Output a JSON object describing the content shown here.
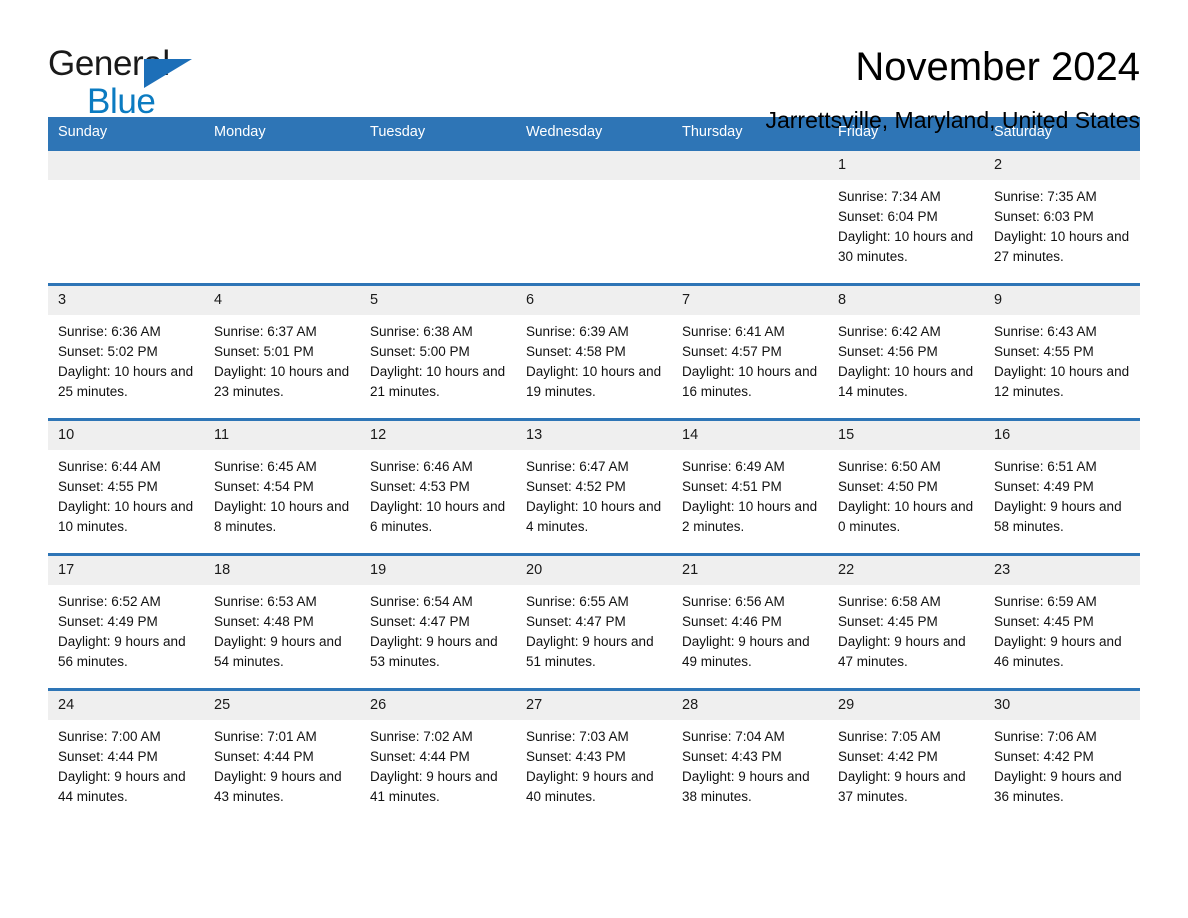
{
  "brand": {
    "name_part1": "General",
    "name_part2": "Blue",
    "triangle_color": "#1d6fb8",
    "blue_text_color": "#0b7bc1"
  },
  "header": {
    "month_title": "November 2024",
    "location": "Jarrettsville, Maryland, United States"
  },
  "theme": {
    "header_blue": "#2e75b6",
    "day_number_bg": "#efefef"
  },
  "calendar": {
    "weekday_headers": [
      "Sunday",
      "Monday",
      "Tuesday",
      "Wednesday",
      "Thursday",
      "Friday",
      "Saturday"
    ],
    "weeks": [
      [
        {
          "day": "",
          "empty": true
        },
        {
          "day": "",
          "empty": true
        },
        {
          "day": "",
          "empty": true
        },
        {
          "day": "",
          "empty": true
        },
        {
          "day": "",
          "empty": true
        },
        {
          "day": "1",
          "sunrise": "Sunrise: 7:34 AM",
          "sunset": "Sunset: 6:04 PM",
          "daylight": "Daylight: 10 hours and 30 minutes."
        },
        {
          "day": "2",
          "sunrise": "Sunrise: 7:35 AM",
          "sunset": "Sunset: 6:03 PM",
          "daylight": "Daylight: 10 hours and 27 minutes."
        }
      ],
      [
        {
          "day": "3",
          "sunrise": "Sunrise: 6:36 AM",
          "sunset": "Sunset: 5:02 PM",
          "daylight": "Daylight: 10 hours and 25 minutes."
        },
        {
          "day": "4",
          "sunrise": "Sunrise: 6:37 AM",
          "sunset": "Sunset: 5:01 PM",
          "daylight": "Daylight: 10 hours and 23 minutes."
        },
        {
          "day": "5",
          "sunrise": "Sunrise: 6:38 AM",
          "sunset": "Sunset: 5:00 PM",
          "daylight": "Daylight: 10 hours and 21 minutes."
        },
        {
          "day": "6",
          "sunrise": "Sunrise: 6:39 AM",
          "sunset": "Sunset: 4:58 PM",
          "daylight": "Daylight: 10 hours and 19 minutes."
        },
        {
          "day": "7",
          "sunrise": "Sunrise: 6:41 AM",
          "sunset": "Sunset: 4:57 PM",
          "daylight": "Daylight: 10 hours and 16 minutes."
        },
        {
          "day": "8",
          "sunrise": "Sunrise: 6:42 AM",
          "sunset": "Sunset: 4:56 PM",
          "daylight": "Daylight: 10 hours and 14 minutes."
        },
        {
          "day": "9",
          "sunrise": "Sunrise: 6:43 AM",
          "sunset": "Sunset: 4:55 PM",
          "daylight": "Daylight: 10 hours and 12 minutes."
        }
      ],
      [
        {
          "day": "10",
          "sunrise": "Sunrise: 6:44 AM",
          "sunset": "Sunset: 4:55 PM",
          "daylight": "Daylight: 10 hours and 10 minutes."
        },
        {
          "day": "11",
          "sunrise": "Sunrise: 6:45 AM",
          "sunset": "Sunset: 4:54 PM",
          "daylight": "Daylight: 10 hours and 8 minutes."
        },
        {
          "day": "12",
          "sunrise": "Sunrise: 6:46 AM",
          "sunset": "Sunset: 4:53 PM",
          "daylight": "Daylight: 10 hours and 6 minutes."
        },
        {
          "day": "13",
          "sunrise": "Sunrise: 6:47 AM",
          "sunset": "Sunset: 4:52 PM",
          "daylight": "Daylight: 10 hours and 4 minutes."
        },
        {
          "day": "14",
          "sunrise": "Sunrise: 6:49 AM",
          "sunset": "Sunset: 4:51 PM",
          "daylight": "Daylight: 10 hours and 2 minutes."
        },
        {
          "day": "15",
          "sunrise": "Sunrise: 6:50 AM",
          "sunset": "Sunset: 4:50 PM",
          "daylight": "Daylight: 10 hours and 0 minutes."
        },
        {
          "day": "16",
          "sunrise": "Sunrise: 6:51 AM",
          "sunset": "Sunset: 4:49 PM",
          "daylight": "Daylight: 9 hours and 58 minutes."
        }
      ],
      [
        {
          "day": "17",
          "sunrise": "Sunrise: 6:52 AM",
          "sunset": "Sunset: 4:49 PM",
          "daylight": "Daylight: 9 hours and 56 minutes."
        },
        {
          "day": "18",
          "sunrise": "Sunrise: 6:53 AM",
          "sunset": "Sunset: 4:48 PM",
          "daylight": "Daylight: 9 hours and 54 minutes."
        },
        {
          "day": "19",
          "sunrise": "Sunrise: 6:54 AM",
          "sunset": "Sunset: 4:47 PM",
          "daylight": "Daylight: 9 hours and 53 minutes."
        },
        {
          "day": "20",
          "sunrise": "Sunrise: 6:55 AM",
          "sunset": "Sunset: 4:47 PM",
          "daylight": "Daylight: 9 hours and 51 minutes."
        },
        {
          "day": "21",
          "sunrise": "Sunrise: 6:56 AM",
          "sunset": "Sunset: 4:46 PM",
          "daylight": "Daylight: 9 hours and 49 minutes."
        },
        {
          "day": "22",
          "sunrise": "Sunrise: 6:58 AM",
          "sunset": "Sunset: 4:45 PM",
          "daylight": "Daylight: 9 hours and 47 minutes."
        },
        {
          "day": "23",
          "sunrise": "Sunrise: 6:59 AM",
          "sunset": "Sunset: 4:45 PM",
          "daylight": "Daylight: 9 hours and 46 minutes."
        }
      ],
      [
        {
          "day": "24",
          "sunrise": "Sunrise: 7:00 AM",
          "sunset": "Sunset: 4:44 PM",
          "daylight": "Daylight: 9 hours and 44 minutes."
        },
        {
          "day": "25",
          "sunrise": "Sunrise: 7:01 AM",
          "sunset": "Sunset: 4:44 PM",
          "daylight": "Daylight: 9 hours and 43 minutes."
        },
        {
          "day": "26",
          "sunrise": "Sunrise: 7:02 AM",
          "sunset": "Sunset: 4:44 PM",
          "daylight": "Daylight: 9 hours and 41 minutes."
        },
        {
          "day": "27",
          "sunrise": "Sunrise: 7:03 AM",
          "sunset": "Sunset: 4:43 PM",
          "daylight": "Daylight: 9 hours and 40 minutes."
        },
        {
          "day": "28",
          "sunrise": "Sunrise: 7:04 AM",
          "sunset": "Sunset: 4:43 PM",
          "daylight": "Daylight: 9 hours and 38 minutes."
        },
        {
          "day": "29",
          "sunrise": "Sunrise: 7:05 AM",
          "sunset": "Sunset: 4:42 PM",
          "daylight": "Daylight: 9 hours and 37 minutes."
        },
        {
          "day": "30",
          "sunrise": "Sunrise: 7:06 AM",
          "sunset": "Sunset: 4:42 PM",
          "daylight": "Daylight: 9 hours and 36 minutes."
        }
      ]
    ]
  }
}
